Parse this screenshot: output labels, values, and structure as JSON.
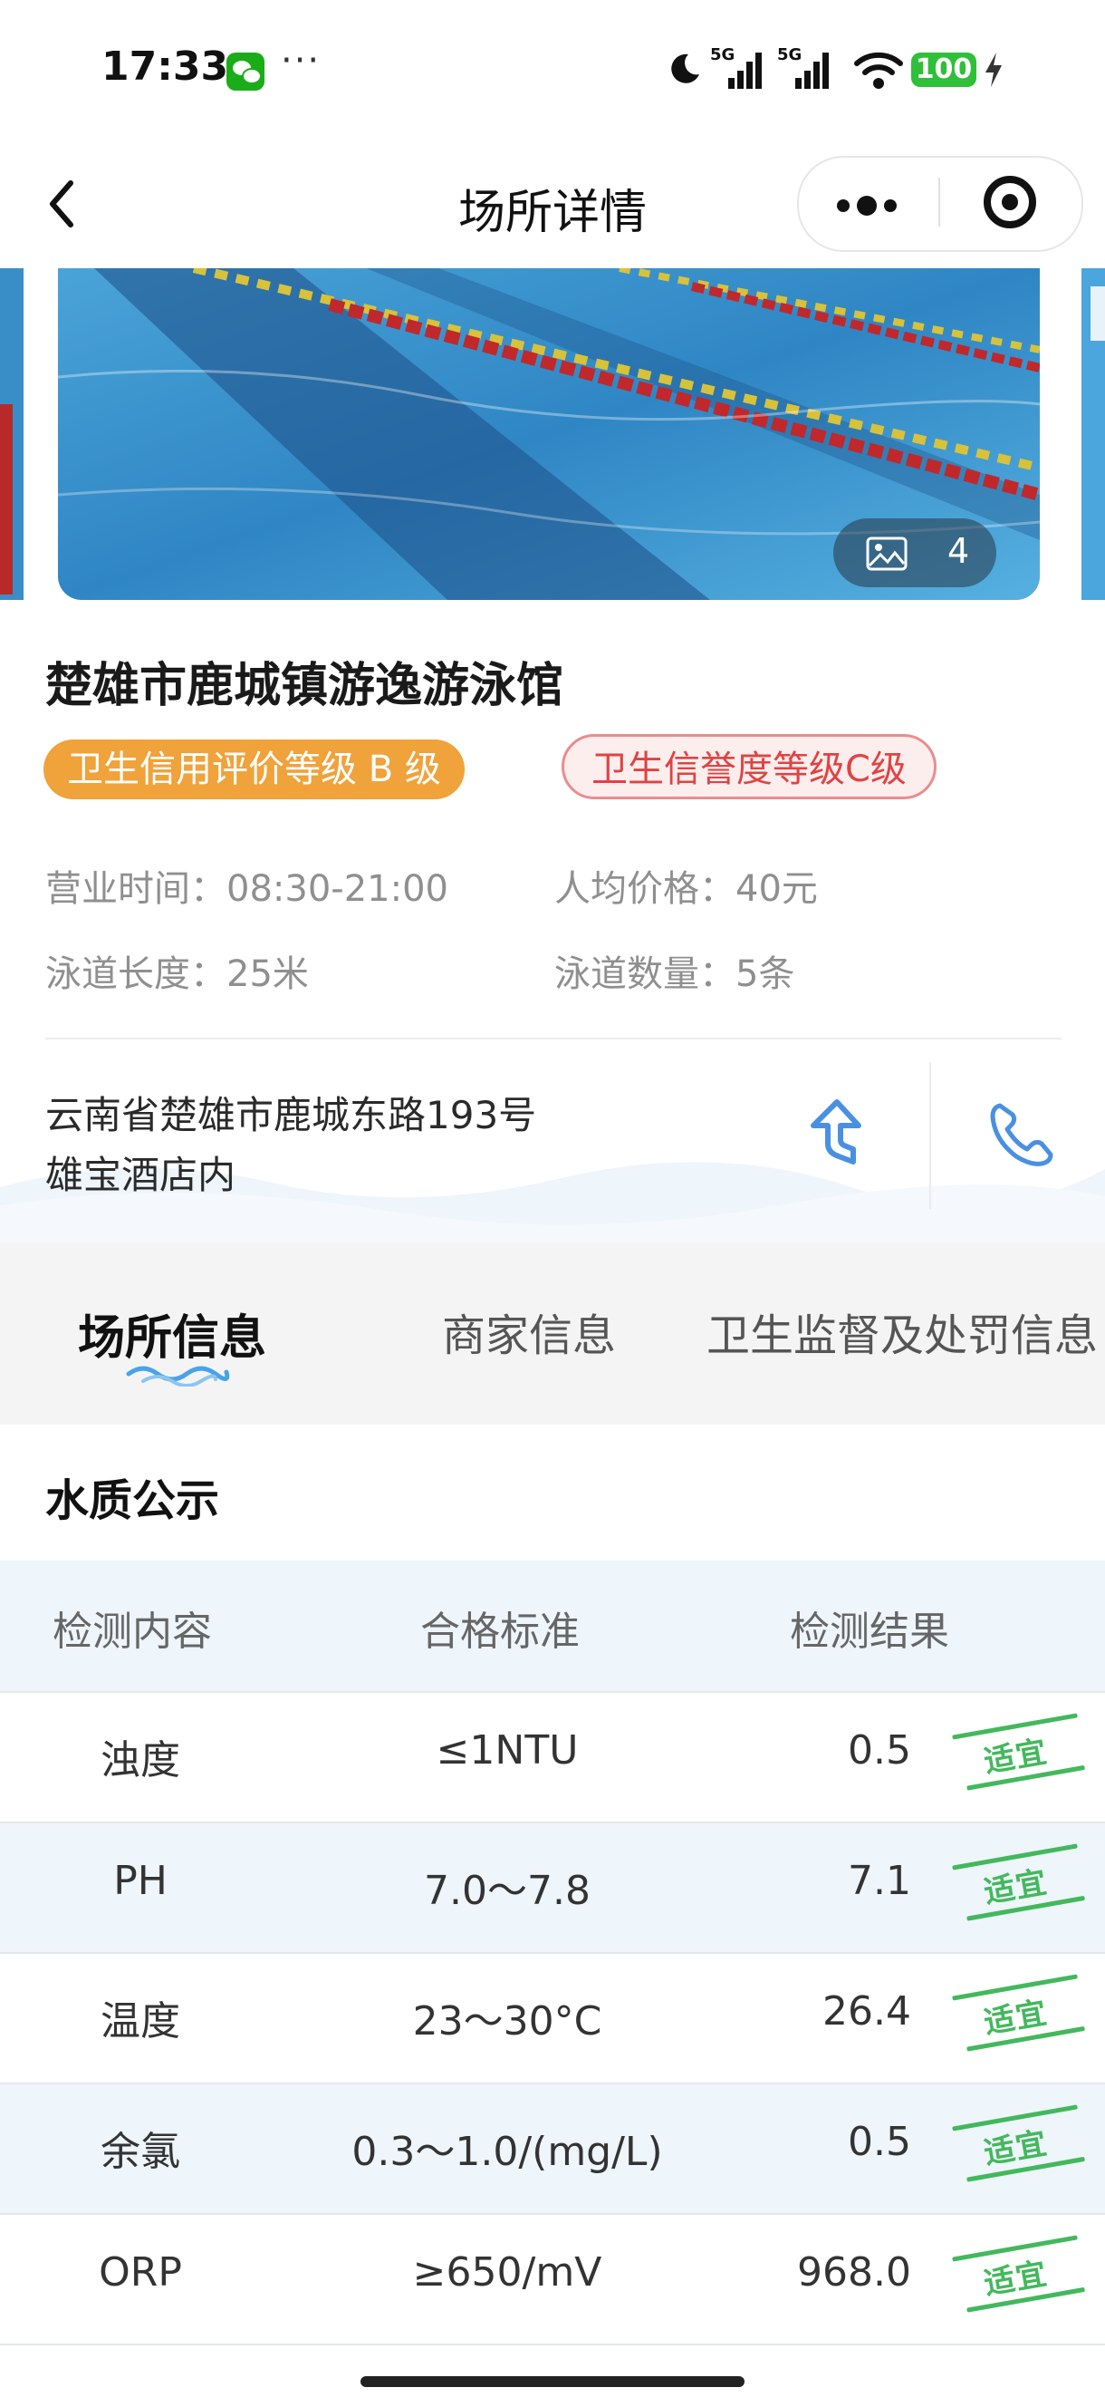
{
  "status_bar": {
    "time": "17:33",
    "more": "···",
    "network_1": "5G",
    "network_2": "5G",
    "battery": "100",
    "icons": [
      "wechat-icon",
      "moon-icon",
      "signal-icon",
      "wifi-icon",
      "charging-icon"
    ]
  },
  "nav": {
    "title": "场所详情",
    "back_icon": "chevron-left-icon",
    "menu_icon": "more-dots-icon",
    "close_icon": "target-circle-icon"
  },
  "gallery": {
    "photo_count": "4",
    "icon": "image-icon"
  },
  "venue": {
    "name": "楚雄市鹿城镇游逸游泳馆",
    "hygiene_rating": "卫生信用评价等级 B 级",
    "credit_rating": "卫生信誉度等级C级",
    "hours_label": "营业时间：",
    "hours_value": "08:30-21:00",
    "price_label": "人均价格：",
    "price_value": "40元",
    "lane_length_label": "泳道长度：",
    "lane_length_value": "25米",
    "lane_count_label": "泳道数量：",
    "lane_count_value": "5条",
    "address_line1": "云南省楚雄市鹿城东路193号",
    "address_line2": "雄宝酒店内",
    "colors": {
      "hygiene_badge": "#f0a23b",
      "credit_badge_text": "#e04343",
      "action_icon": "#4a90e2"
    }
  },
  "tabs": [
    {
      "label": "场所信息",
      "active": true
    },
    {
      "label": "商家信息",
      "active": false
    },
    {
      "label": "卫生监督及处罚信息",
      "active": false
    }
  ],
  "water_quality": {
    "title": "水质公示",
    "headers": [
      "检测内容",
      "合格标准",
      "检测结果"
    ],
    "rows": [
      {
        "item": "浊度",
        "standard": "≤1NTU",
        "result": "0.5",
        "status": "适宜"
      },
      {
        "item": "PH",
        "standard": "7.0～7.8",
        "result": "7.1",
        "status": "适宜"
      },
      {
        "item": "温度",
        "standard": "23～30°C",
        "result": "26.4",
        "status": "适宜"
      },
      {
        "item": "余氯",
        "standard": "0.3～1.0/(mg/L)",
        "result": "0.5",
        "status": "适宜"
      },
      {
        "item": "ORP",
        "standard": "≥650/mV",
        "result": "968.0",
        "status": "适宜"
      }
    ],
    "status_color": "#43b85c"
  }
}
